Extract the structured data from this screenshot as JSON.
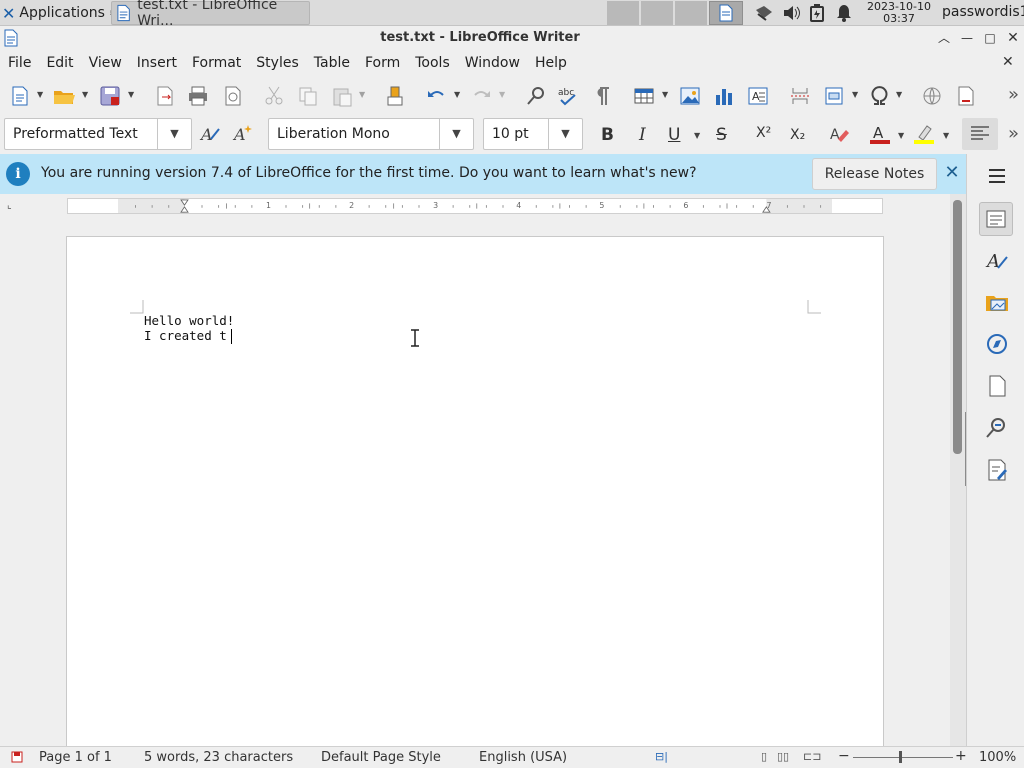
{
  "taskbar": {
    "applications_label": "Applications",
    "task_label": "test.txt - LibreOffice Wri...",
    "clock_date": "2023-10-10",
    "clock_time": "03:37",
    "user": "passwordis1"
  },
  "window": {
    "title": "test.txt - LibreOffice Writer"
  },
  "menu": [
    "File",
    "Edit",
    "View",
    "Insert",
    "Format",
    "Styles",
    "Table",
    "Form",
    "Tools",
    "Window",
    "Help"
  ],
  "toolbar": {
    "paragraph_style": "Preformatted Text",
    "font_name": "Liberation Mono",
    "font_size": "10 pt",
    "bold": "B",
    "italic": "I",
    "underline": "U",
    "strike": "S",
    "superscript": "X²",
    "subscript": "X₂"
  },
  "infobar": {
    "message": "You are running version 7.4 of LibreOffice for the first time. Do you want to learn what's new?",
    "button": "Release Notes"
  },
  "document": {
    "lines": [
      "Hello world!",
      "I created t"
    ]
  },
  "status": {
    "page": "Page 1 of 1",
    "words": "5 words, 23 characters",
    "page_style": "Default Page Style",
    "language": "English (USA)",
    "zoom": "100%"
  },
  "colors": {
    "font_color": "#c9211e",
    "highlight_color": "#ffff00",
    "info_bg": "#bde5f8"
  }
}
